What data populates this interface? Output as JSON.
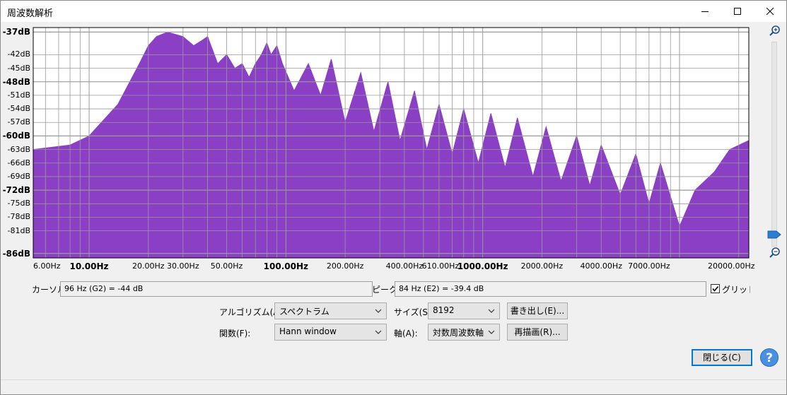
{
  "window": {
    "title": "周波数解析"
  },
  "plot": {
    "y_labels": [
      {
        "text": "-37dB",
        "major": true,
        "db": -37
      },
      {
        "text": "-42dB",
        "major": false,
        "db": -42
      },
      {
        "text": "-45dB",
        "major": false,
        "db": -45
      },
      {
        "text": "-48dB",
        "major": true,
        "db": -48
      },
      {
        "text": "-51dB",
        "major": false,
        "db": -51
      },
      {
        "text": "-54dB",
        "major": false,
        "db": -54
      },
      {
        "text": "-57dB",
        "major": false,
        "db": -57
      },
      {
        "text": "-60dB",
        "major": true,
        "db": -60
      },
      {
        "text": "-63dB",
        "major": false,
        "db": -63
      },
      {
        "text": "-66dB",
        "major": false,
        "db": -66
      },
      {
        "text": "-69dB",
        "major": false,
        "db": -69
      },
      {
        "text": "-72dB",
        "major": true,
        "db": -72
      },
      {
        "text": "-75dB",
        "major": false,
        "db": -75
      },
      {
        "text": "-78dB",
        "major": false,
        "db": -78
      },
      {
        "text": "-81dB",
        "major": false,
        "db": -81
      },
      {
        "text": "-86dB",
        "major": true,
        "db": -86
      }
    ],
    "x_labels": [
      {
        "text": "6.00Hz",
        "hz": 6,
        "major": false
      },
      {
        "text": "10.00Hz",
        "hz": 10,
        "major": true
      },
      {
        "text": "20.00Hz",
        "hz": 20,
        "major": false
      },
      {
        "text": "30.00Hz",
        "hz": 30,
        "major": false
      },
      {
        "text": "50.00Hz",
        "hz": 50,
        "major": false
      },
      {
        "text": "100.00Hz",
        "hz": 100,
        "major": true
      },
      {
        "text": "200.00Hz",
        "hz": 200,
        "major": false
      },
      {
        "text": "400.00Hz",
        "hz": 400,
        "major": false
      },
      {
        "text": "610.00Hz",
        "hz": 610,
        "major": false
      },
      {
        "text": "1000.00Hz",
        "hz": 1000,
        "major": true
      },
      {
        "text": "2000.00Hz",
        "hz": 2000,
        "major": false
      },
      {
        "text": "4000.00Hz",
        "hz": 4000,
        "major": false
      },
      {
        "text": "7000.00Hz",
        "hz": 7000,
        "major": false
      },
      {
        "text": "20000.00Hz",
        "hz": 20000,
        "major": false
      }
    ],
    "fill_color": "#8a3fc5",
    "grid_color": "#9a9a9a"
  },
  "chart_data": {
    "type": "area",
    "x_scale": "log",
    "xlim": [
      5.2,
      22500
    ],
    "ylim": [
      -87,
      -36
    ],
    "grid": true,
    "x": [
      5.2,
      8,
      10,
      14,
      18,
      20,
      22,
      25,
      30,
      34,
      37,
      40,
      45,
      50,
      55,
      60,
      65,
      70,
      75,
      80,
      84,
      90,
      96,
      110,
      130,
      150,
      170,
      200,
      240,
      280,
      330,
      380,
      450,
      520,
      600,
      700,
      800,
      950,
      1100,
      1300,
      1500,
      1800,
      2100,
      2500,
      3000,
      3500,
      4000,
      5000,
      6000,
      7000,
      8000,
      10000,
      12000,
      15000,
      18000,
      22500
    ],
    "y": [
      -63,
      -62,
      -60,
      -53,
      -44,
      -40,
      -38,
      -37,
      -38,
      -40,
      -39,
      -38,
      -44,
      -42,
      -45,
      -44,
      -47,
      -44,
      -42,
      -39.4,
      -42,
      -40,
      -44,
      -50,
      -44,
      -51,
      -43,
      -57,
      -46,
      -59,
      -48,
      -61,
      -50,
      -63,
      -53,
      -64,
      -54,
      -66,
      -55,
      -67,
      -56,
      -69,
      -58,
      -70,
      -60,
      -71,
      -62,
      -73,
      -64,
      -75,
      -66,
      -80,
      -72,
      -68,
      -63,
      -61
    ]
  },
  "cursor": {
    "label": "カーソル:",
    "value": "96 Hz (G2) = -44 dB"
  },
  "peak": {
    "label": "ピーク:",
    "value": "84 Hz (E2) = -39.4 dB"
  },
  "grid": {
    "label": "グリッド(",
    "checked": true
  },
  "algorithm": {
    "label": "アルゴリズム(A):",
    "value": "スペクトラム"
  },
  "size": {
    "label": "サイズ(S):",
    "value": "8192"
  },
  "export_button": "書き出し(E)...",
  "function": {
    "label": "関数(F):",
    "value": "Hann window"
  },
  "axis": {
    "label": "軸(A):",
    "value": "対数周波数軸"
  },
  "replot_button": "再描画(R)...",
  "close_button": "閉じる(C)",
  "help_glyph": "?"
}
